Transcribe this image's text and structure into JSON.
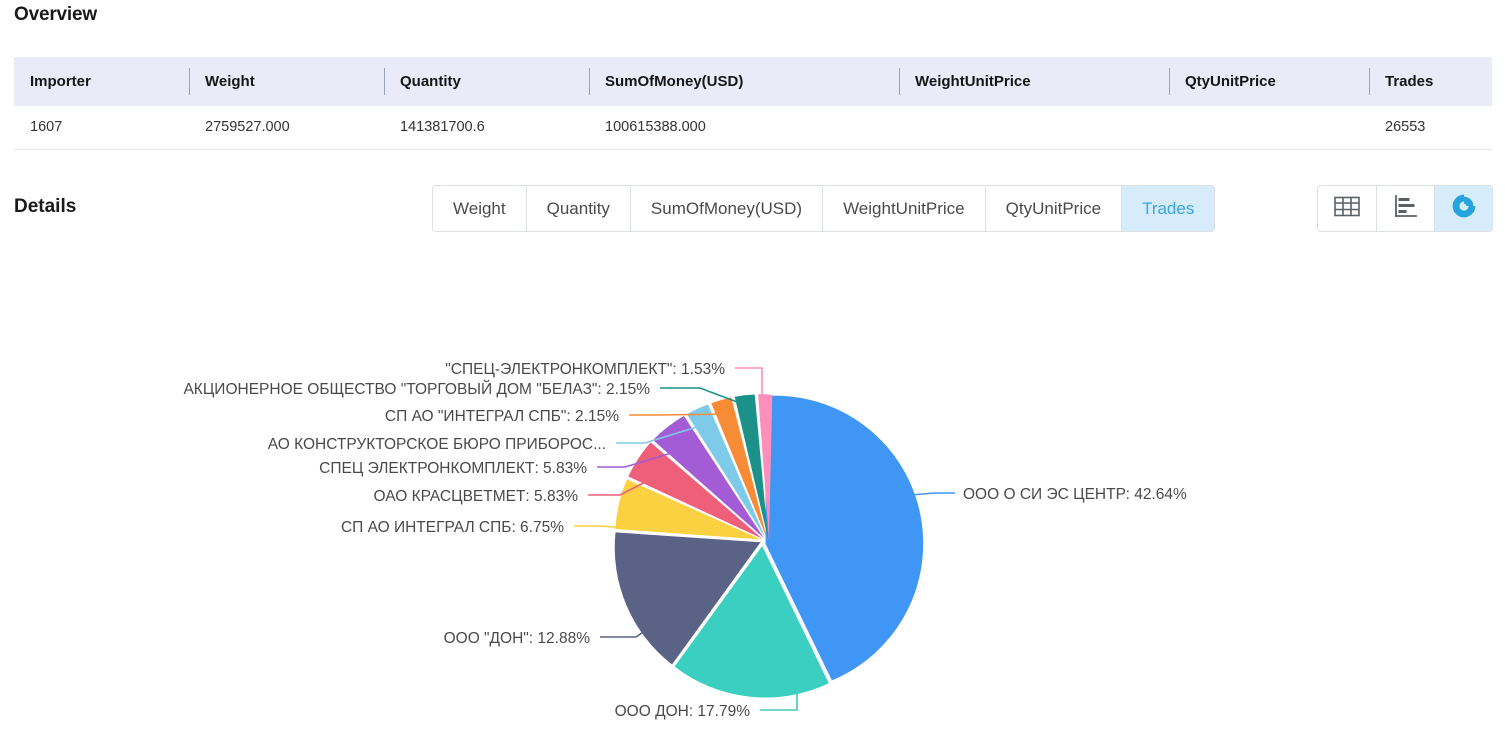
{
  "overview": {
    "title": "Overview",
    "columns": [
      "Importer",
      "Weight",
      "Quantity",
      "SumOfMoney(USD)",
      "WeightUnitPrice",
      "QtyUnitPrice",
      "Trades"
    ],
    "rows": [
      {
        "Importer": "1607",
        "Weight": "2759527.000",
        "Quantity": "141381700.6",
        "SumOfMoney(USD)": "100615388.000",
        "WeightUnitPrice": "",
        "QtyUnitPrice": "",
        "Trades": "26553"
      }
    ]
  },
  "details": {
    "title": "Details",
    "metric_tabs": [
      {
        "label": "Weight",
        "active": false
      },
      {
        "label": "Quantity",
        "active": false
      },
      {
        "label": "SumOfMoney(USD)",
        "active": false
      },
      {
        "label": "WeightUnitPrice",
        "active": false
      },
      {
        "label": "QtyUnitPrice",
        "active": false
      },
      {
        "label": "Trades",
        "active": true
      }
    ],
    "view_buttons": [
      {
        "icon": "table-view-icon",
        "active": false
      },
      {
        "icon": "bar-chart-view-icon",
        "active": false
      },
      {
        "icon": "pie-chart-view-icon",
        "active": true
      }
    ]
  },
  "colors": {
    "accent": "#3aa6e0",
    "tab_active_bg": "#d6ecfa",
    "table_header_bg": "#e9ecf8",
    "border": "#dcdfe6"
  },
  "chart_data": {
    "type": "pie",
    "title": "",
    "metric": "Trades",
    "legend_position": "labels-with-leader-lines",
    "labels": [
      "ООО О СИ ЭС ЦЕНТР",
      "ООО ДОН",
      "ООО \"ДОН\"",
      "СП АО ИНТЕГРАЛ СПБ",
      "ОАО КРАСЦВЕТМЕТ",
      "СПЕЦ ЭЛЕКТРОНКОМПЛЕКТ",
      "АО КОНСТРУКТОРСКОЕ БЮРО ПРИБОРОС...",
      "СП АО \"ИНТЕГРАЛ СПБ\"",
      "АКЦИОНЕРНОЕ ОБЩЕСТВО \"ТОРГОВЫЙ ДОМ \"БЕЛАЗ\"",
      "\"СПЕЦ-ЭЛЕКТРОНКОМПЛЕКТ\""
    ],
    "values": [
      42.64,
      17.79,
      12.88,
      6.75,
      5.83,
      5.83,
      2.45,
      2.15,
      2.15,
      1.53
    ],
    "percent_labels": [
      "42.64%",
      "17.79%",
      "12.88%",
      "6.75%",
      "5.83%",
      "5.83%",
      "",
      "2.15%",
      "2.15%",
      "1.53%"
    ],
    "display_labels": [
      "ООО О СИ ЭС ЦЕНТР:  42.64%",
      "ООО ДОН:  17.79%",
      "ООО \"ДОН\":  12.88%",
      "СП АО ИНТЕГРАЛ СПБ:  6.75%",
      "ОАО КРАСЦВЕТМЕТ:  5.83%",
      "СПЕЦ ЭЛЕКТРОНКОМПЛЕКТ:  5.83%",
      "АО КОНСТРУКТОРСКОЕ БЮРО ПРИБОРОС...",
      "СП АО \"ИНТЕГРАЛ СПБ\":  2.15%",
      "АКЦИОНЕРНОЕ ОБЩЕСТВО \"ТОРГОВЫЙ ДОМ \"БЕЛАЗ\":  2.15%",
      "\"СПЕЦ-ЭЛЕКТРОНКОМПЛЕКТ\":  1.53%"
    ],
    "slice_colors": [
      "#4096f5",
      "#3acfc0",
      "#5a6386",
      "#fad141",
      "#ef5f7a",
      "#a35cd6",
      "#7dcbe8",
      "#f88b36",
      "#1b9189",
      "#fc8fbb"
    ]
  }
}
